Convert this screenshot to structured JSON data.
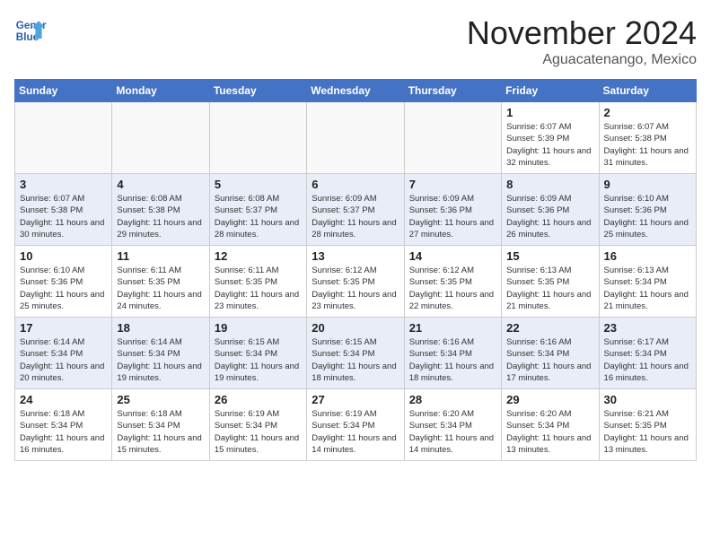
{
  "header": {
    "logo_line1": "General",
    "logo_line2": "Blue",
    "month": "November 2024",
    "location": "Aguacatenango, Mexico"
  },
  "days_of_week": [
    "Sunday",
    "Monday",
    "Tuesday",
    "Wednesday",
    "Thursday",
    "Friday",
    "Saturday"
  ],
  "weeks": [
    [
      {
        "day": "",
        "empty": true
      },
      {
        "day": "",
        "empty": true
      },
      {
        "day": "",
        "empty": true
      },
      {
        "day": "",
        "empty": true
      },
      {
        "day": "",
        "empty": true
      },
      {
        "day": "1",
        "sunrise": "6:07 AM",
        "sunset": "5:39 PM",
        "daylight": "11 hours and 32 minutes."
      },
      {
        "day": "2",
        "sunrise": "6:07 AM",
        "sunset": "5:38 PM",
        "daylight": "11 hours and 31 minutes."
      }
    ],
    [
      {
        "day": "3",
        "sunrise": "6:07 AM",
        "sunset": "5:38 PM",
        "daylight": "11 hours and 30 minutes."
      },
      {
        "day": "4",
        "sunrise": "6:08 AM",
        "sunset": "5:38 PM",
        "daylight": "11 hours and 29 minutes."
      },
      {
        "day": "5",
        "sunrise": "6:08 AM",
        "sunset": "5:37 PM",
        "daylight": "11 hours and 28 minutes."
      },
      {
        "day": "6",
        "sunrise": "6:09 AM",
        "sunset": "5:37 PM",
        "daylight": "11 hours and 28 minutes."
      },
      {
        "day": "7",
        "sunrise": "6:09 AM",
        "sunset": "5:36 PM",
        "daylight": "11 hours and 27 minutes."
      },
      {
        "day": "8",
        "sunrise": "6:09 AM",
        "sunset": "5:36 PM",
        "daylight": "11 hours and 26 minutes."
      },
      {
        "day": "9",
        "sunrise": "6:10 AM",
        "sunset": "5:36 PM",
        "daylight": "11 hours and 25 minutes."
      }
    ],
    [
      {
        "day": "10",
        "sunrise": "6:10 AM",
        "sunset": "5:36 PM",
        "daylight": "11 hours and 25 minutes."
      },
      {
        "day": "11",
        "sunrise": "6:11 AM",
        "sunset": "5:35 PM",
        "daylight": "11 hours and 24 minutes."
      },
      {
        "day": "12",
        "sunrise": "6:11 AM",
        "sunset": "5:35 PM",
        "daylight": "11 hours and 23 minutes."
      },
      {
        "day": "13",
        "sunrise": "6:12 AM",
        "sunset": "5:35 PM",
        "daylight": "11 hours and 23 minutes."
      },
      {
        "day": "14",
        "sunrise": "6:12 AM",
        "sunset": "5:35 PM",
        "daylight": "11 hours and 22 minutes."
      },
      {
        "day": "15",
        "sunrise": "6:13 AM",
        "sunset": "5:35 PM",
        "daylight": "11 hours and 21 minutes."
      },
      {
        "day": "16",
        "sunrise": "6:13 AM",
        "sunset": "5:34 PM",
        "daylight": "11 hours and 21 minutes."
      }
    ],
    [
      {
        "day": "17",
        "sunrise": "6:14 AM",
        "sunset": "5:34 PM",
        "daylight": "11 hours and 20 minutes."
      },
      {
        "day": "18",
        "sunrise": "6:14 AM",
        "sunset": "5:34 PM",
        "daylight": "11 hours and 19 minutes."
      },
      {
        "day": "19",
        "sunrise": "6:15 AM",
        "sunset": "5:34 PM",
        "daylight": "11 hours and 19 minutes."
      },
      {
        "day": "20",
        "sunrise": "6:15 AM",
        "sunset": "5:34 PM",
        "daylight": "11 hours and 18 minutes."
      },
      {
        "day": "21",
        "sunrise": "6:16 AM",
        "sunset": "5:34 PM",
        "daylight": "11 hours and 18 minutes."
      },
      {
        "day": "22",
        "sunrise": "6:16 AM",
        "sunset": "5:34 PM",
        "daylight": "11 hours and 17 minutes."
      },
      {
        "day": "23",
        "sunrise": "6:17 AM",
        "sunset": "5:34 PM",
        "daylight": "11 hours and 16 minutes."
      }
    ],
    [
      {
        "day": "24",
        "sunrise": "6:18 AM",
        "sunset": "5:34 PM",
        "daylight": "11 hours and 16 minutes."
      },
      {
        "day": "25",
        "sunrise": "6:18 AM",
        "sunset": "5:34 PM",
        "daylight": "11 hours and 15 minutes."
      },
      {
        "day": "26",
        "sunrise": "6:19 AM",
        "sunset": "5:34 PM",
        "daylight": "11 hours and 15 minutes."
      },
      {
        "day": "27",
        "sunrise": "6:19 AM",
        "sunset": "5:34 PM",
        "daylight": "11 hours and 14 minutes."
      },
      {
        "day": "28",
        "sunrise": "6:20 AM",
        "sunset": "5:34 PM",
        "daylight": "11 hours and 14 minutes."
      },
      {
        "day": "29",
        "sunrise": "6:20 AM",
        "sunset": "5:34 PM",
        "daylight": "11 hours and 13 minutes."
      },
      {
        "day": "30",
        "sunrise": "6:21 AM",
        "sunset": "5:35 PM",
        "daylight": "11 hours and 13 minutes."
      }
    ]
  ]
}
